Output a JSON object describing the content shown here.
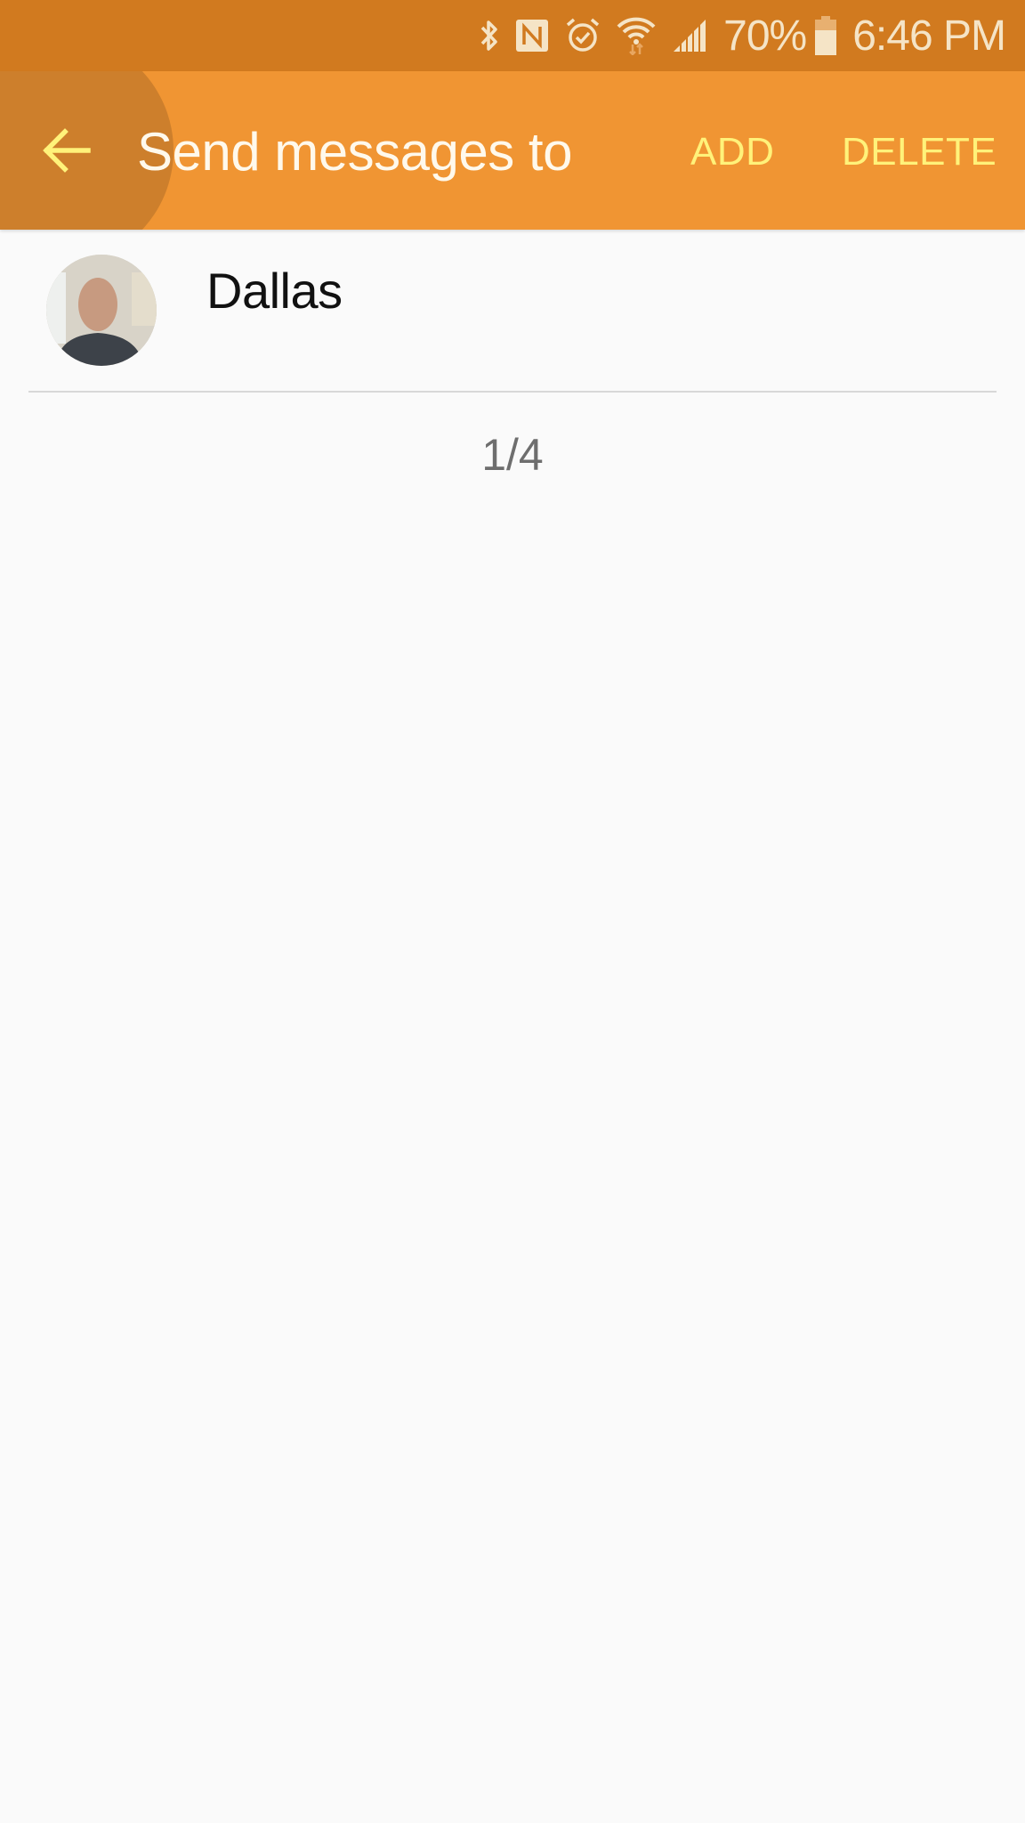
{
  "status_bar": {
    "icons": [
      "bluetooth-icon",
      "nfc-icon",
      "alarm-icon",
      "wifi-icon",
      "signal-icon",
      "battery-icon"
    ],
    "battery_percent": "70%",
    "battery_level": 0.7,
    "time": "6:46 PM"
  },
  "toolbar": {
    "back_icon": "arrow-left-icon",
    "title": "Send messages to",
    "add_label": "ADD",
    "delete_label": "DELETE"
  },
  "recipients": [
    {
      "name": "Dallas"
    }
  ],
  "page_indicator": "1/4",
  "colors": {
    "status_bar": "#d17a1f",
    "toolbar": "#f09533",
    "action_text": "#fff27a",
    "background": "#fafafa"
  }
}
